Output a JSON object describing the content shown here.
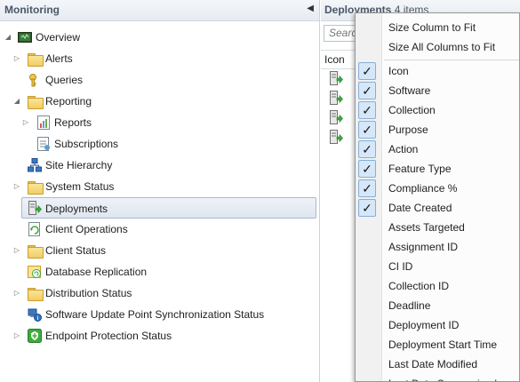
{
  "nav": {
    "title": "Monitoring",
    "collapse_glyph": "◀",
    "items": [
      {
        "label": "Overview",
        "icon": "overview-console-icon"
      },
      {
        "label": "Alerts",
        "icon": "folder-icon"
      },
      {
        "label": "Queries",
        "icon": "query-key-icon"
      },
      {
        "label": "Reporting",
        "icon": "folder-icon"
      },
      {
        "label": "Reports",
        "icon": "report-chart-icon"
      },
      {
        "label": "Subscriptions",
        "icon": "subscription-icon"
      },
      {
        "label": "Site Hierarchy",
        "icon": "site-hierarchy-icon"
      },
      {
        "label": "System Status",
        "icon": "folder-icon"
      },
      {
        "label": "Deployments",
        "icon": "deployment-icon"
      },
      {
        "label": "Client Operations",
        "icon": "client-operations-icon"
      },
      {
        "label": "Client Status",
        "icon": "folder-icon"
      },
      {
        "label": "Database Replication",
        "icon": "database-replication-icon"
      },
      {
        "label": "Distribution Status",
        "icon": "folder-icon"
      },
      {
        "label": "Software Update Point Synchronization Status",
        "icon": "sync-status-icon"
      },
      {
        "label": "Endpoint Protection Status",
        "icon": "endpoint-protection-icon"
      }
    ]
  },
  "content": {
    "title": "Deployments",
    "count": "4 items",
    "search_placeholder": "Search",
    "column_header": "Icon",
    "row_icon": "deployment-icon"
  },
  "menu": {
    "top_items": [
      "Size Column to Fit",
      "Size All Columns to Fit"
    ],
    "check_glyph": "✓",
    "columns": [
      {
        "label": "Icon",
        "checked": true
      },
      {
        "label": "Software",
        "checked": true
      },
      {
        "label": "Collection",
        "checked": true
      },
      {
        "label": "Purpose",
        "checked": true
      },
      {
        "label": "Action",
        "checked": true
      },
      {
        "label": "Feature Type",
        "checked": true
      },
      {
        "label": "Compliance %",
        "checked": true
      },
      {
        "label": "Date Created",
        "checked": true
      },
      {
        "label": "Assets Targeted",
        "checked": false
      },
      {
        "label": "Assignment ID",
        "checked": false
      },
      {
        "label": "CI ID",
        "checked": false
      },
      {
        "label": "Collection ID",
        "checked": false
      },
      {
        "label": "Deadline",
        "checked": false
      },
      {
        "label": "Deployment ID",
        "checked": false
      },
      {
        "label": "Deployment Start Time",
        "checked": false
      },
      {
        "label": "Last Date Modified",
        "checked": false
      },
      {
        "label": "Last Date Summarized",
        "checked": false
      }
    ]
  },
  "colors": {
    "selection_border": "#a9b9cf",
    "check_background": "#d5e7f8",
    "folder": "#f1cd62"
  }
}
